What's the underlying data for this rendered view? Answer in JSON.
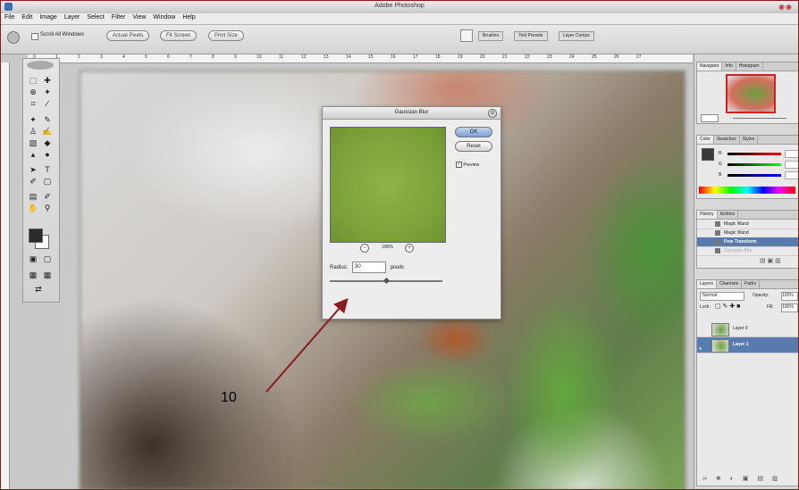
{
  "window": {
    "title": "Adobe Photoshop"
  },
  "menubar": [
    "File",
    "Edit",
    "Image",
    "Layer",
    "Select",
    "Filter",
    "View",
    "Window",
    "Help"
  ],
  "options_bar": {
    "scroll_all_windows_label": "Scroll All Windows",
    "actual_pixels_label": "Actual Pixels",
    "fit_screen_label": "Fit Screen",
    "print_size_label": "Print Size",
    "well_tabs": [
      "Brushes",
      "Tool Presets",
      "Layer Comps"
    ]
  },
  "ruler_ticks": [
    "0",
    "1",
    "2",
    "3",
    "4",
    "5",
    "6",
    "7",
    "8",
    "9",
    "10",
    "11",
    "12",
    "13",
    "14",
    "15",
    "16",
    "17",
    "18",
    "19",
    "20",
    "21",
    "22",
    "23",
    "24",
    "25",
    "26",
    "27"
  ],
  "dialog": {
    "title": "Gaussian Blur",
    "ok_label": "OK",
    "reset_label": "Reset",
    "preview_label": "Preview",
    "preview_checked": true,
    "zoom_value": "100%",
    "radius_label": "Radius:",
    "radius_value": "30",
    "radius_unit": "pixels",
    "radius_slider_fraction": 0.5
  },
  "navigator_panel": {
    "tabs": [
      "Navigator",
      "Info",
      "Histogram"
    ]
  },
  "color_panel": {
    "tabs": [
      "Color",
      "Swatches",
      "Styles"
    ],
    "channels": [
      {
        "label": "R",
        "gradient": "linear-gradient(90deg,#000,#f00)"
      },
      {
        "label": "G",
        "gradient": "linear-gradient(90deg,#000,#0f0)"
      },
      {
        "label": "B",
        "gradient": "linear-gradient(90deg,#000,#00f)"
      }
    ]
  },
  "history_panel": {
    "tabs": [
      "History",
      "Actions"
    ],
    "items": [
      {
        "label": "Magic Wand",
        "state": "normal"
      },
      {
        "label": "Magic Wand",
        "state": "normal"
      },
      {
        "label": "Free Transform",
        "state": "selected"
      },
      {
        "label": "Gaussian Blur",
        "state": "dim"
      }
    ]
  },
  "layers_panel": {
    "tabs": [
      "Layers",
      "Channels",
      "Paths"
    ],
    "blend_mode": "Normal",
    "opacity_label": "Opacity:",
    "opacity_value": "100%",
    "lock_label": "Lock:",
    "fill_label": "Fill:",
    "fill_value": "100%",
    "layers": [
      {
        "name": "Layer 0",
        "selected": false,
        "visible": false
      },
      {
        "name": "Layer 1",
        "selected": true,
        "visible": true
      }
    ]
  },
  "annotation": {
    "number": "10",
    "color": "#8b1a1a"
  }
}
